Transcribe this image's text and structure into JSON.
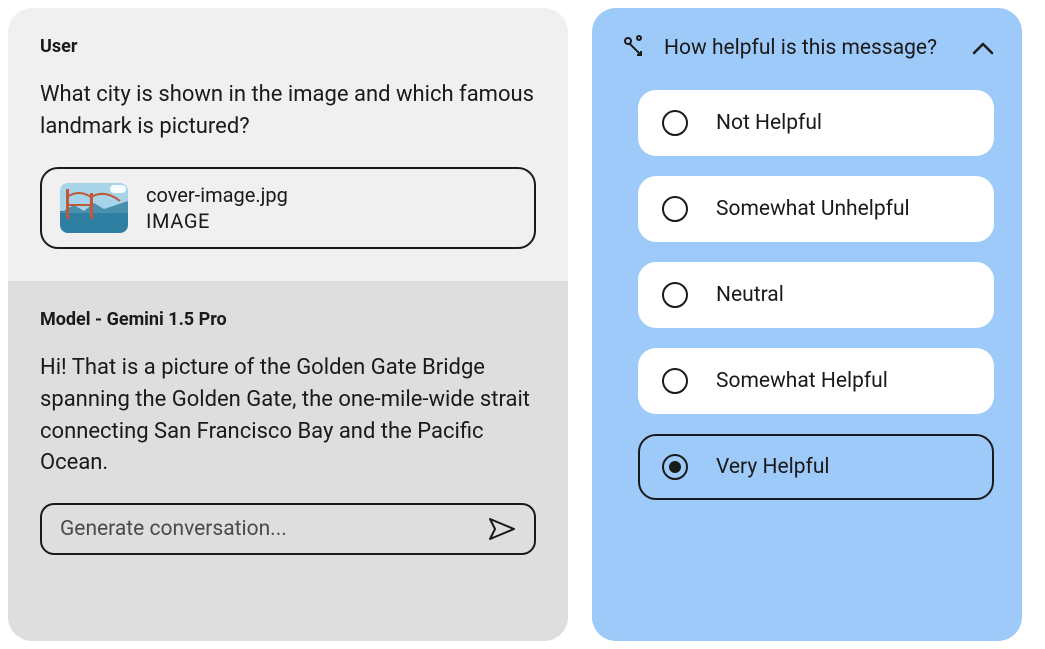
{
  "user": {
    "label": "User",
    "question": "What city is shown in the image and which famous landmark is pictured?",
    "attachment": {
      "filename": "cover-image.jpg",
      "type": "IMAGE"
    }
  },
  "model": {
    "label": "Model - Gemini 1.5 Pro",
    "answer": "Hi! That is a picture of the Golden Gate Bridge spanning the Golden Gate, the one-mile-wide strait connecting San Francisco Bay and the Pacific Ocean.",
    "input_placeholder": "Generate conversation..."
  },
  "rating": {
    "title": "How helpful is this message?",
    "options": [
      {
        "label": "Not Helpful",
        "selected": false
      },
      {
        "label": "Somewhat Unhelpful",
        "selected": false
      },
      {
        "label": "Neutral",
        "selected": false
      },
      {
        "label": "Somewhat Helpful",
        "selected": false
      },
      {
        "label": "Very Helpful",
        "selected": true
      }
    ]
  }
}
